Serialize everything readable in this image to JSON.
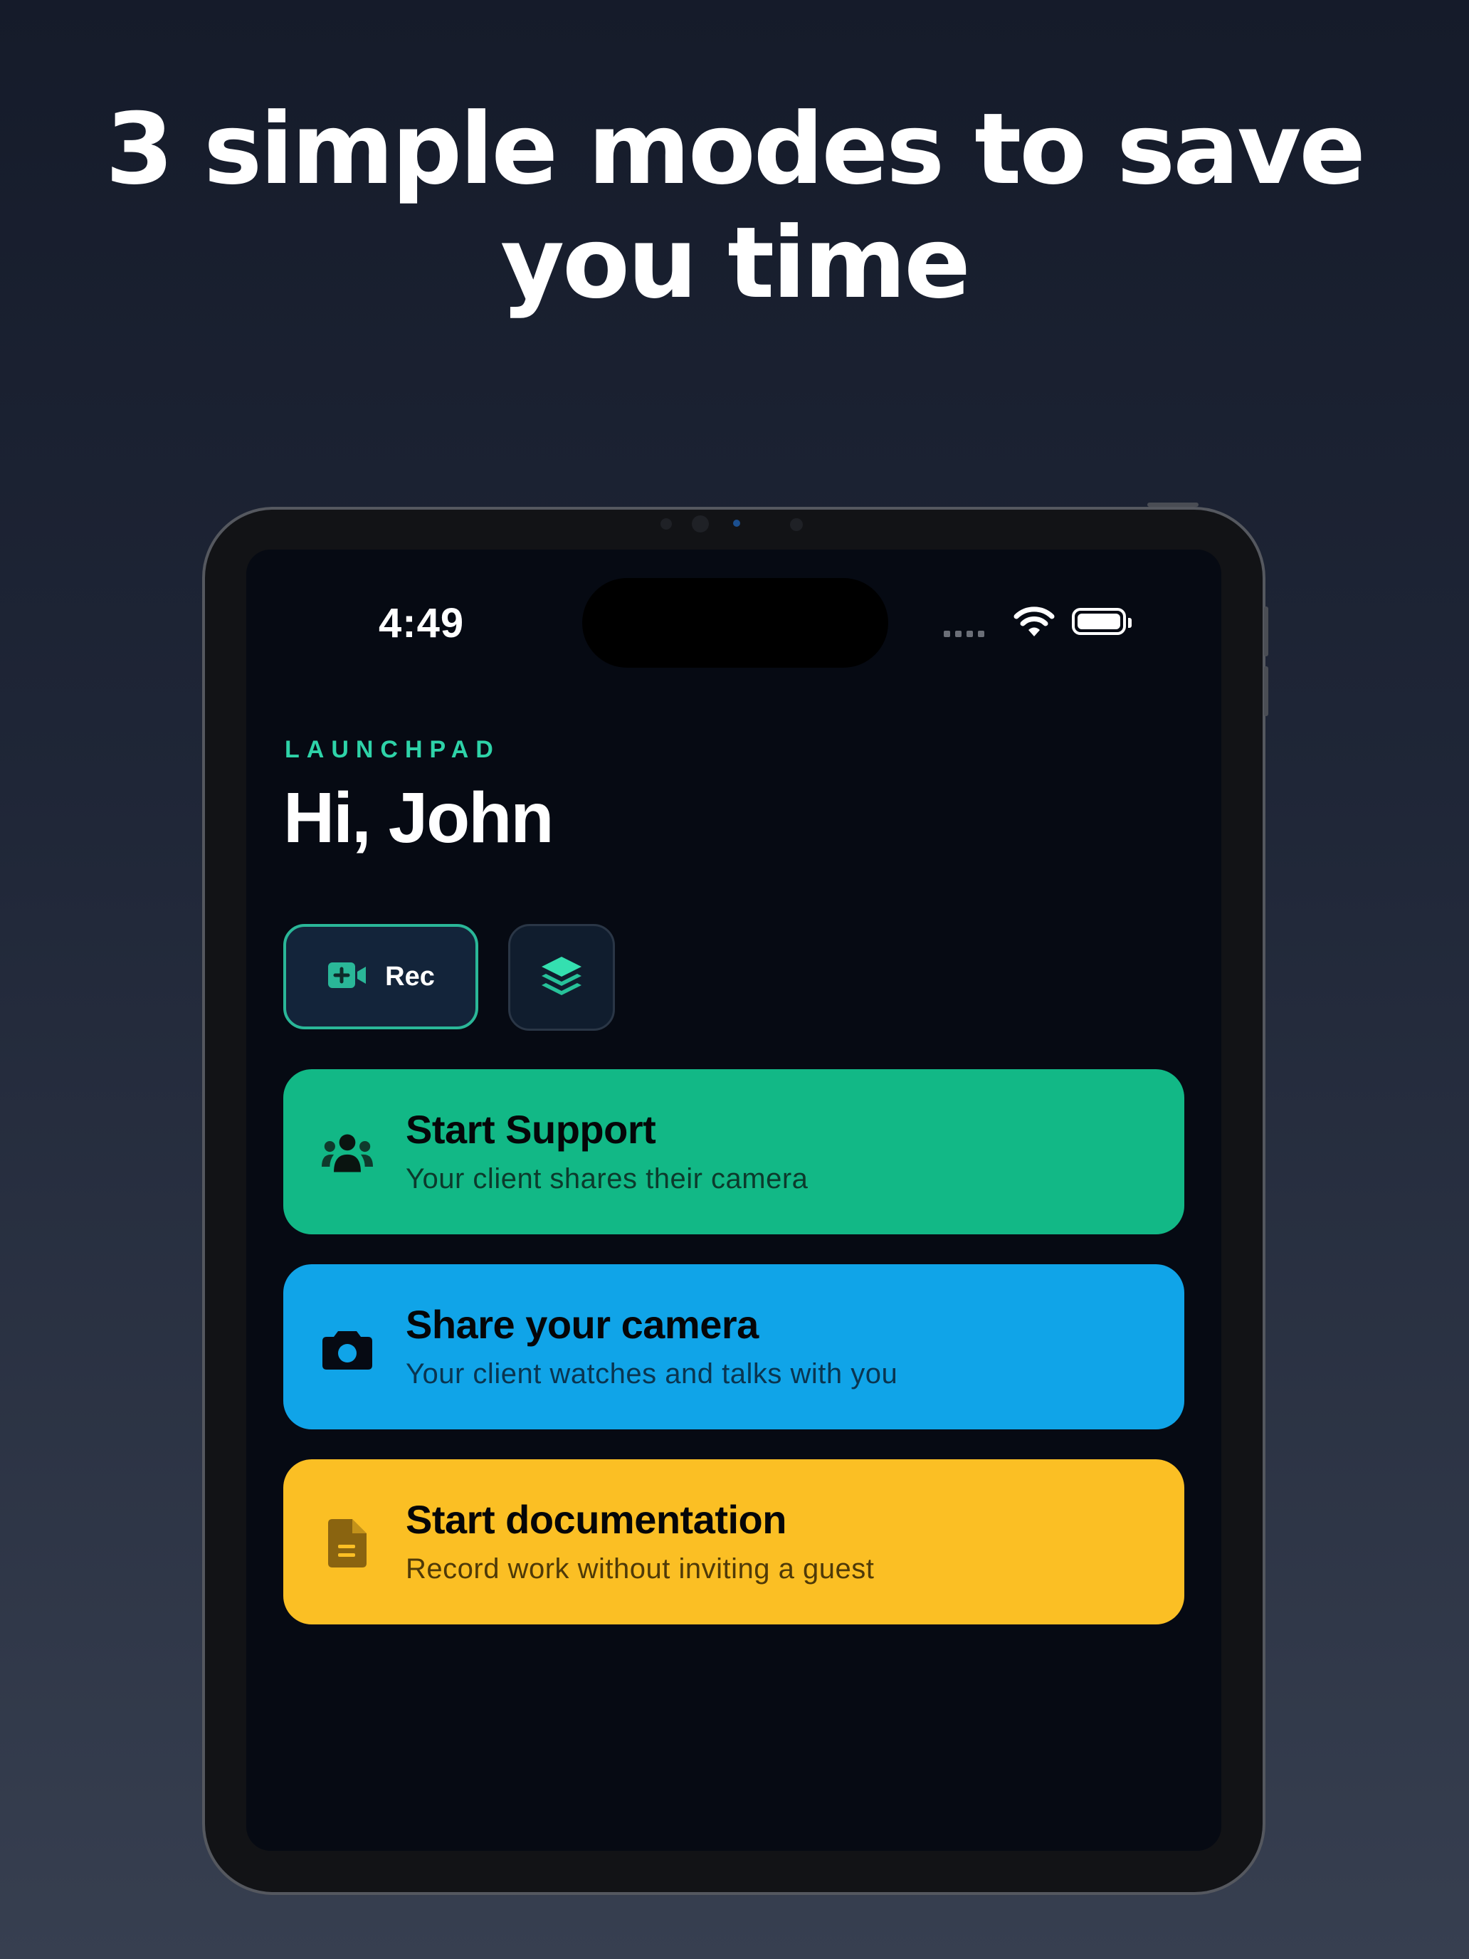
{
  "headline": {
    "line1": "3 simple modes to save",
    "line2": "you time"
  },
  "status_bar": {
    "time": "4:49",
    "wifi_icon": "wifi-icon",
    "battery_icon": "battery-icon"
  },
  "header": {
    "eyebrow": "LAUNCHPAD",
    "greeting": "Hi, John"
  },
  "quick_actions": {
    "rec_label": "Rec",
    "rec_icon": "video-add-icon",
    "layers_icon": "layers-icon"
  },
  "modes": [
    {
      "title": "Start Support",
      "subtitle": "Your client shares their camera",
      "icon": "users-icon",
      "color": "#12b886"
    },
    {
      "title": "Share your camera",
      "subtitle": "Your client watches and talks with you",
      "icon": "camera-icon",
      "color": "#10a4e8"
    },
    {
      "title": "Start documentation",
      "subtitle": "Record work without inviting a guest",
      "icon": "document-icon",
      "color": "#fbbf24"
    }
  ],
  "colors": {
    "accent": "#2ed3a8",
    "screen_bg": "#060a13"
  }
}
